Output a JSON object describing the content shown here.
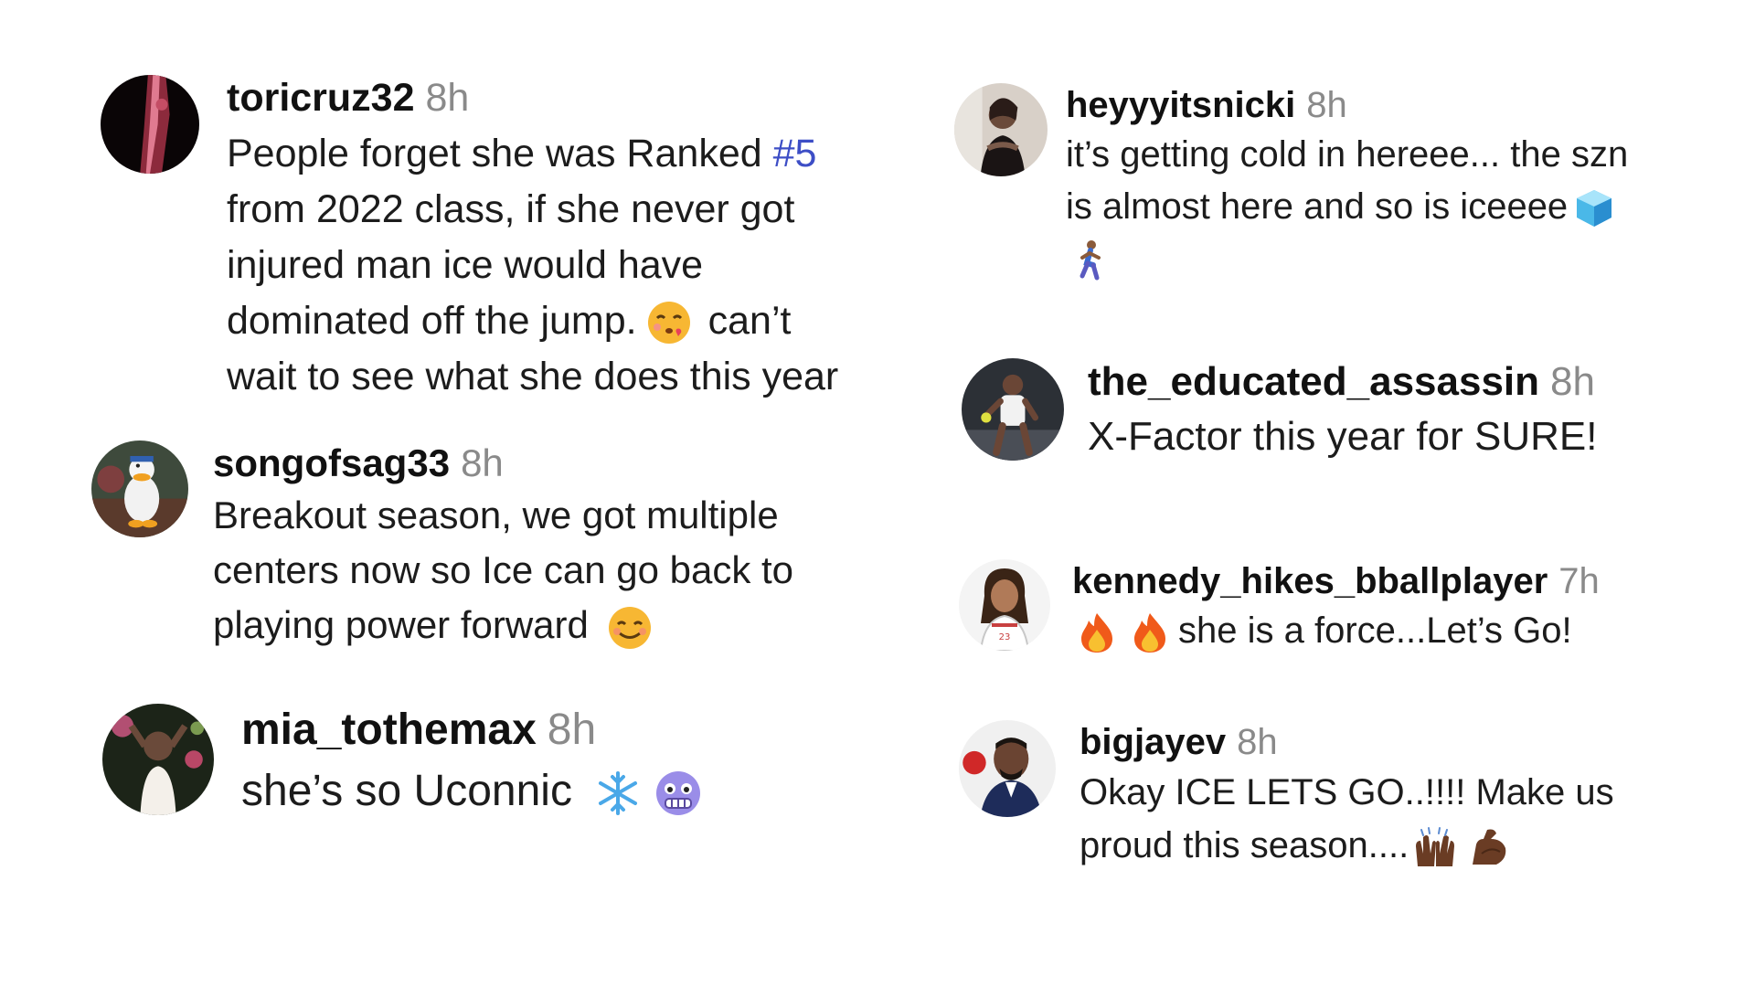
{
  "comments": [
    {
      "username": "toricruz32",
      "time": "8h",
      "lines": [
        "People forget she was Ranked",
        "from 2022 class, if she never got",
        "injured man ice would have",
        "dominated off the jump.",
        "wait to see what she does this year"
      ],
      "hashtag": "#5",
      "line4_tail": "can’t",
      "emoji": [
        "face-blowing-kiss-emoji"
      ]
    },
    {
      "username": "songofsag33",
      "time": "8h",
      "lines": [
        "Breakout season, we got multiple",
        "centers now so Ice can go back to",
        "playing power forward"
      ],
      "emoji": [
        "smiling-face-emoji"
      ]
    },
    {
      "username": "mia_tothemax",
      "time": "8h",
      "lines": [
        "she’s so Uconnic"
      ],
      "emoji": [
        "snowflake-emoji",
        "cold-face-emoji"
      ]
    },
    {
      "username": "heyyyitsnicki",
      "time": "8h",
      "lines": [
        "it’s getting cold in hereee... the szn",
        "is almost here and so is iceeee"
      ],
      "emoji": [
        "ice-cube-emoji",
        "person-running-emoji"
      ]
    },
    {
      "username": "the_educated_assassin",
      "time": "8h",
      "lines": [
        "X-Factor this year for SURE!"
      ]
    },
    {
      "username": "kennedy_hikes_bballplayer",
      "time": "7h",
      "lines": [
        "she is a force...Let’s Go!"
      ],
      "emoji": [
        "fire-emoji",
        "fire-emoji"
      ]
    },
    {
      "username": "bigjayev",
      "time": "8h",
      "lines": [
        "Okay ICE LETS GO..!!!! Make us",
        "proud this season...."
      ],
      "emoji": [
        "raising-hands-emoji",
        "flexed-biceps-emoji"
      ]
    }
  ],
  "colors": {
    "text": "#1c1c1c",
    "username": "#111111",
    "timestamp": "#8a8a8a",
    "hashtag": "#3d4ec6"
  }
}
